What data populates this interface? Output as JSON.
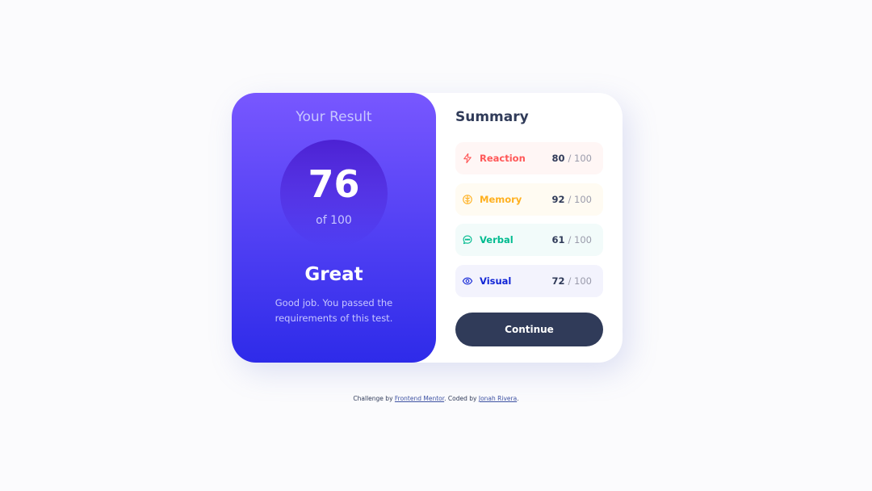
{
  "result": {
    "title": "Your Result",
    "score": "76",
    "of": "of 100",
    "rating": "Great",
    "message": "Good job. You passed the requirements of this test."
  },
  "summary": {
    "title": "Summary",
    "items": [
      {
        "label": "Reaction",
        "score": "80",
        "max": "/ 100",
        "icon": "lightning-icon",
        "color": "#ff5757"
      },
      {
        "label": "Memory",
        "score": "92",
        "max": "/ 100",
        "icon": "brain-icon",
        "color": "#ffb01f"
      },
      {
        "label": "Verbal",
        "score": "61",
        "max": "/ 100",
        "icon": "speech-bubble-icon",
        "color": "#00bb8f"
      },
      {
        "label": "Visual",
        "score": "72",
        "max": "/ 100",
        "icon": "eye-icon",
        "color": "#1125d6"
      }
    ],
    "continue_label": "Continue"
  },
  "footer": {
    "prefix": "Challenge by",
    "challenge_link": "Frontend Mentor",
    "middle": ". Coded by",
    "author_link": "Jonah Rivera",
    "suffix": "."
  },
  "colors": {
    "gradient_top": "#7857ff",
    "gradient_bottom": "#2e2be9",
    "button": "#303b59"
  }
}
